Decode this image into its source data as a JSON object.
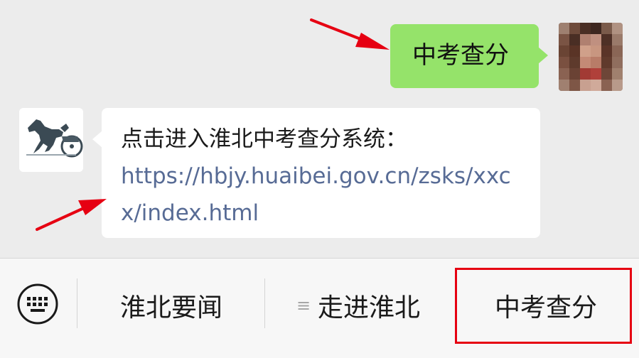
{
  "chat": {
    "outgoing": {
      "text": "中考查分"
    },
    "incoming": {
      "line1": "点击进入淮北中考查分系统：",
      "link": "https://hbjy.huaibei.gov.cn/zsks/xxcx/index.html"
    }
  },
  "menu": {
    "keyboard_icon": "keyboard-icon",
    "items": [
      {
        "label": "淮北要闻"
      },
      {
        "label": "走进淮北",
        "icon": "list-icon"
      },
      {
        "label": "中考查分"
      }
    ]
  },
  "colors": {
    "outgoing_bubble": "#95e36a",
    "link": "#576b95",
    "annotation_red": "#e60012",
    "background": "#ececec"
  }
}
